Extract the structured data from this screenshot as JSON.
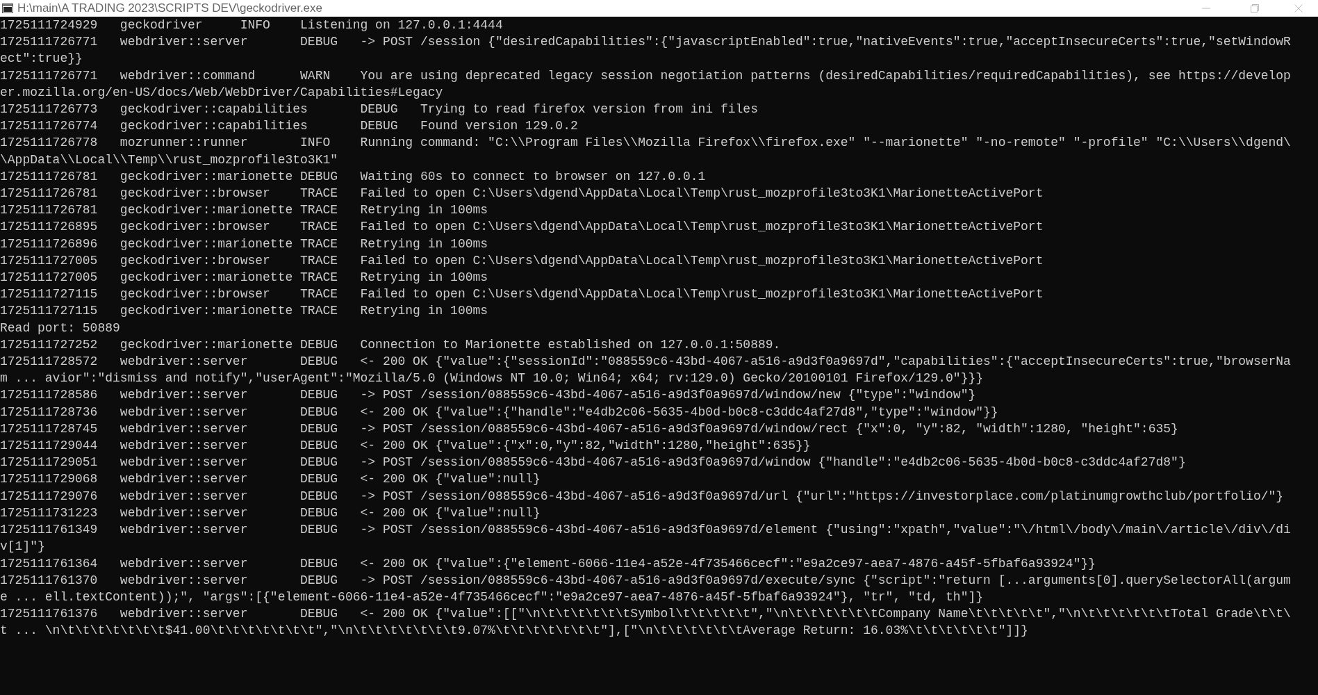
{
  "window": {
    "title": "H:\\main\\A TRADING 2023\\SCRIPTS DEV\\geckodriver.exe"
  },
  "console": {
    "lines": [
      "1725111724929   geckodriver     INFO    Listening on 127.0.0.1:4444",
      "1725111726771   webdriver::server       DEBUG   -> POST /session {\"desiredCapabilities\":{\"javascriptEnabled\":true,\"nativeEvents\":true,\"acceptInsecureCerts\":true,\"setWindowR",
      "ect\":true}}",
      "1725111726771   webdriver::command      WARN    You are using deprecated legacy session negotiation patterns (desiredCapabilities/requiredCapabilities), see https://develop",
      "er.mozilla.org/en-US/docs/Web/WebDriver/Capabilities#Legacy",
      "1725111726773   geckodriver::capabilities       DEBUG   Trying to read firefox version from ini files",
      "1725111726774   geckodriver::capabilities       DEBUG   Found version 129.0.2",
      "1725111726778   mozrunner::runner       INFO    Running command: \"C:\\\\Program Files\\\\Mozilla Firefox\\\\firefox.exe\" \"--marionette\" \"-no-remote\" \"-profile\" \"C:\\\\Users\\\\dgend\\",
      "\\AppData\\\\Local\\\\Temp\\\\rust_mozprofile3to3K1\"",
      "1725111726781   geckodriver::marionette DEBUG   Waiting 60s to connect to browser on 127.0.0.1",
      "1725111726781   geckodriver::browser    TRACE   Failed to open C:\\Users\\dgend\\AppData\\Local\\Temp\\rust_mozprofile3to3K1\\MarionetteActivePort",
      "1725111726781   geckodriver::marionette TRACE   Retrying in 100ms",
      "1725111726895   geckodriver::browser    TRACE   Failed to open C:\\Users\\dgend\\AppData\\Local\\Temp\\rust_mozprofile3to3K1\\MarionetteActivePort",
      "1725111726896   geckodriver::marionette TRACE   Retrying in 100ms",
      "1725111727005   geckodriver::browser    TRACE   Failed to open C:\\Users\\dgend\\AppData\\Local\\Temp\\rust_mozprofile3to3K1\\MarionetteActivePort",
      "1725111727005   geckodriver::marionette TRACE   Retrying in 100ms",
      "1725111727115   geckodriver::browser    TRACE   Failed to open C:\\Users\\dgend\\AppData\\Local\\Temp\\rust_mozprofile3to3K1\\MarionetteActivePort",
      "1725111727115   geckodriver::marionette TRACE   Retrying in 100ms",
      "Read port: 50889",
      "1725111727252   geckodriver::marionette DEBUG   Connection to Marionette established on 127.0.0.1:50889.",
      "1725111728572   webdriver::server       DEBUG   <- 200 OK {\"value\":{\"sessionId\":\"088559c6-43bd-4067-a516-a9d3f0a9697d\",\"capabilities\":{\"acceptInsecureCerts\":true,\"browserNa",
      "m ... avior\":\"dismiss and notify\",\"userAgent\":\"Mozilla/5.0 (Windows NT 10.0; Win64; x64; rv:129.0) Gecko/20100101 Firefox/129.0\"}}}",
      "1725111728586   webdriver::server       DEBUG   -> POST /session/088559c6-43bd-4067-a516-a9d3f0a9697d/window/new {\"type\":\"window\"}",
      "1725111728736   webdriver::server       DEBUG   <- 200 OK {\"value\":{\"handle\":\"e4db2c06-5635-4b0d-b0c8-c3ddc4af27d8\",\"type\":\"window\"}}",
      "1725111728745   webdriver::server       DEBUG   -> POST /session/088559c6-43bd-4067-a516-a9d3f0a9697d/window/rect {\"x\":0, \"y\":82, \"width\":1280, \"height\":635}",
      "1725111729044   webdriver::server       DEBUG   <- 200 OK {\"value\":{\"x\":0,\"y\":82,\"width\":1280,\"height\":635}}",
      "1725111729051   webdriver::server       DEBUG   -> POST /session/088559c6-43bd-4067-a516-a9d3f0a9697d/window {\"handle\":\"e4db2c06-5635-4b0d-b0c8-c3ddc4af27d8\"}",
      "1725111729068   webdriver::server       DEBUG   <- 200 OK {\"value\":null}",
      "1725111729076   webdriver::server       DEBUG   -> POST /session/088559c6-43bd-4067-a516-a9d3f0a9697d/url {\"url\":\"https://investorplace.com/platinumgrowthclub/portfolio/\"}",
      "1725111731223   webdriver::server       DEBUG   <- 200 OK {\"value\":null}",
      "1725111761349   webdriver::server       DEBUG   -> POST /session/088559c6-43bd-4067-a516-a9d3f0a9697d/element {\"using\":\"xpath\",\"value\":\"\\/html\\/body\\/main\\/article\\/div\\/di",
      "v[1]\"}",
      "1725111761364   webdriver::server       DEBUG   <- 200 OK {\"value\":{\"element-6066-11e4-a52e-4f735466cecf\":\"e9a2ce97-aea7-4876-a45f-5fbaf6a93924\"}}",
      "1725111761370   webdriver::server       DEBUG   -> POST /session/088559c6-43bd-4067-a516-a9d3f0a9697d/execute/sync {\"script\":\"return [...arguments[0].querySelectorAll(argum",
      "e ... ell.textContent));\", \"args\":[{\"element-6066-11e4-a52e-4f735466cecf\":\"e9a2ce97-aea7-4876-a45f-5fbaf6a93924\"}, \"tr\", \"td, th\"]}",
      "1725111761376   webdriver::server       DEBUG   <- 200 OK {\"value\":[[\"\\n\\t\\t\\t\\t\\t\\tSymbol\\t\\t\\t\\t\\t\",\"\\n\\t\\t\\t\\t\\t\\tCompany Name\\t\\t\\t\\t\\t\",\"\\n\\t\\t\\t\\t\\t\\tTotal Grade\\t\\t\\",
      "t ... \\n\\t\\t\\t\\t\\t\\t\\t$41.00\\t\\t\\t\\t\\t\\t\\t\",\"\\n\\t\\t\\t\\t\\t\\t\\t9.07%\\t\\t\\t\\t\\t\\t\\t\"],[\"\\n\\t\\t\\t\\t\\t\\tAverage Return: 16.03%\\t\\t\\t\\t\\t\\t\"]]}"
    ]
  }
}
